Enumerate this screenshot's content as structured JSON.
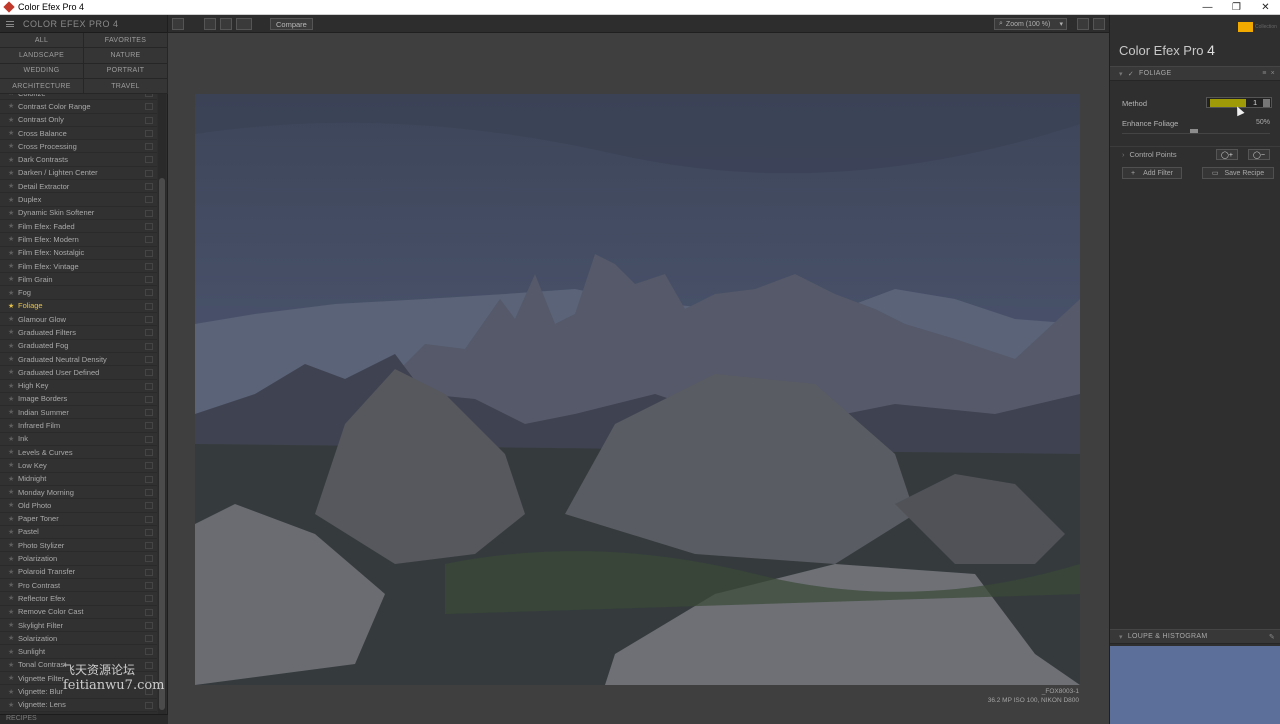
{
  "window": {
    "title": "Color Efex Pro 4",
    "controls": [
      "—",
      "❐",
      "✕"
    ]
  },
  "left_panel": {
    "app_name": "COLOR EFEX PRO 4",
    "categories": [
      "ALL",
      "FAVORITES",
      "LANDSCAPE",
      "NATURE",
      "WEDDING",
      "PORTRAIT",
      "ARCHITECTURE",
      "TRAVEL"
    ],
    "filters": [
      "Colorize",
      "Contrast Color Range",
      "Contrast Only",
      "Cross Balance",
      "Cross Processing",
      "Dark Contrasts",
      "Darken / Lighten Center",
      "Detail Extractor",
      "Duplex",
      "Dynamic Skin Softener",
      "Film Efex: Faded",
      "Film Efex: Modern",
      "Film Efex: Nostalgic",
      "Film Efex: Vintage",
      "Film Grain",
      "Fog",
      "Foliage",
      "Glamour Glow",
      "Graduated Filters",
      "Graduated Fog",
      "Graduated Neutral Density",
      "Graduated User Defined",
      "High Key",
      "Image Borders",
      "Indian Summer",
      "Infrared Film",
      "Ink",
      "Levels & Curves",
      "Low Key",
      "Midnight",
      "Monday Morning",
      "Old Photo",
      "Paper Toner",
      "Pastel",
      "Photo Stylizer",
      "Polarization",
      "Polaroid Transfer",
      "Pro Contrast",
      "Reflector Efex",
      "Remove Color Cast",
      "Skylight Filter",
      "Solarization",
      "Sunlight",
      "Tonal Contrast",
      "Vignette Filter",
      "Vignette: Blur",
      "Vignette: Lens"
    ],
    "active_filter": "Foliage",
    "active_color": "#e6c14a",
    "recipes_label": "RECIPES"
  },
  "toolbar": {
    "compare_label": "Compare",
    "zoom_label": "Zoom (100 %)",
    "zoom_icon": "search-icon"
  },
  "photo": {
    "filename": "_FOX8003-1",
    "info": "36.2 MP ISO 100, NIKON D800"
  },
  "watermark": {
    "line1": "飞天资源论坛",
    "line2": "feitianwu7.com"
  },
  "right_panel": {
    "brand_sub": "Collection",
    "product_name": "Color Efex Pro",
    "product_number": "4",
    "filter_section_title": "FOLIAGE",
    "method_label": "Method",
    "method_value": "1",
    "enhance_label": "Enhance Foliage",
    "enhance_value": "50%",
    "enhance_fraction": 0.5,
    "control_points_label": "Control Points",
    "add_filter_label": "Add Filter",
    "save_recipe_label": "Save Recipe",
    "loupe_title": "LOUPE & HISTOGRAM",
    "brand_color": "#f2a900",
    "method_highlight_color": "#c9c300"
  }
}
